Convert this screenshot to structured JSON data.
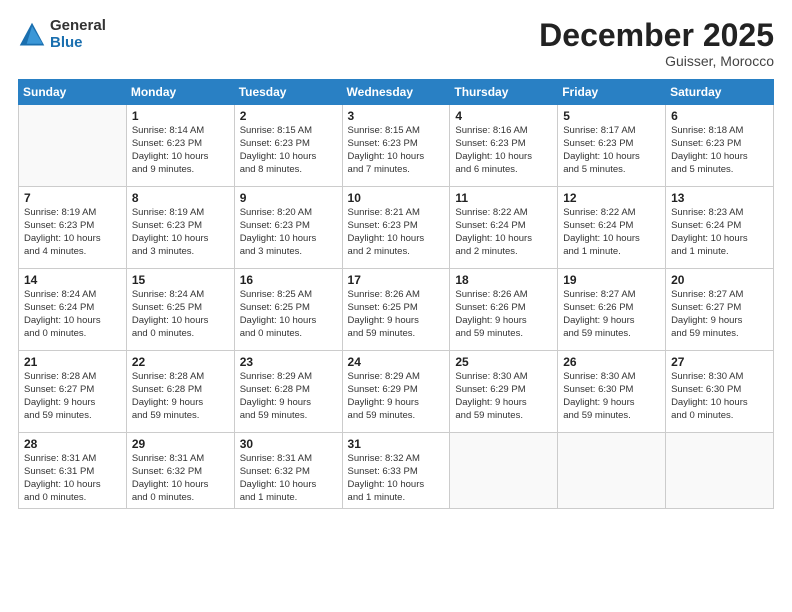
{
  "logo": {
    "general": "General",
    "blue": "Blue"
  },
  "title": "December 2025",
  "location": "Guisser, Morocco",
  "weekdays": [
    "Sunday",
    "Monday",
    "Tuesday",
    "Wednesday",
    "Thursday",
    "Friday",
    "Saturday"
  ],
  "weeks": [
    [
      {
        "day": "",
        "info": ""
      },
      {
        "day": "1",
        "info": "Sunrise: 8:14 AM\nSunset: 6:23 PM\nDaylight: 10 hours\nand 9 minutes."
      },
      {
        "day": "2",
        "info": "Sunrise: 8:15 AM\nSunset: 6:23 PM\nDaylight: 10 hours\nand 8 minutes."
      },
      {
        "day": "3",
        "info": "Sunrise: 8:15 AM\nSunset: 6:23 PM\nDaylight: 10 hours\nand 7 minutes."
      },
      {
        "day": "4",
        "info": "Sunrise: 8:16 AM\nSunset: 6:23 PM\nDaylight: 10 hours\nand 6 minutes."
      },
      {
        "day": "5",
        "info": "Sunrise: 8:17 AM\nSunset: 6:23 PM\nDaylight: 10 hours\nand 5 minutes."
      },
      {
        "day": "6",
        "info": "Sunrise: 8:18 AM\nSunset: 6:23 PM\nDaylight: 10 hours\nand 5 minutes."
      }
    ],
    [
      {
        "day": "7",
        "info": "Sunrise: 8:19 AM\nSunset: 6:23 PM\nDaylight: 10 hours\nand 4 minutes."
      },
      {
        "day": "8",
        "info": "Sunrise: 8:19 AM\nSunset: 6:23 PM\nDaylight: 10 hours\nand 3 minutes."
      },
      {
        "day": "9",
        "info": "Sunrise: 8:20 AM\nSunset: 6:23 PM\nDaylight: 10 hours\nand 3 minutes."
      },
      {
        "day": "10",
        "info": "Sunrise: 8:21 AM\nSunset: 6:23 PM\nDaylight: 10 hours\nand 2 minutes."
      },
      {
        "day": "11",
        "info": "Sunrise: 8:22 AM\nSunset: 6:24 PM\nDaylight: 10 hours\nand 2 minutes."
      },
      {
        "day": "12",
        "info": "Sunrise: 8:22 AM\nSunset: 6:24 PM\nDaylight: 10 hours\nand 1 minute."
      },
      {
        "day": "13",
        "info": "Sunrise: 8:23 AM\nSunset: 6:24 PM\nDaylight: 10 hours\nand 1 minute."
      }
    ],
    [
      {
        "day": "14",
        "info": "Sunrise: 8:24 AM\nSunset: 6:24 PM\nDaylight: 10 hours\nand 0 minutes."
      },
      {
        "day": "15",
        "info": "Sunrise: 8:24 AM\nSunset: 6:25 PM\nDaylight: 10 hours\nand 0 minutes."
      },
      {
        "day": "16",
        "info": "Sunrise: 8:25 AM\nSunset: 6:25 PM\nDaylight: 10 hours\nand 0 minutes."
      },
      {
        "day": "17",
        "info": "Sunrise: 8:26 AM\nSunset: 6:25 PM\nDaylight: 9 hours\nand 59 minutes."
      },
      {
        "day": "18",
        "info": "Sunrise: 8:26 AM\nSunset: 6:26 PM\nDaylight: 9 hours\nand 59 minutes."
      },
      {
        "day": "19",
        "info": "Sunrise: 8:27 AM\nSunset: 6:26 PM\nDaylight: 9 hours\nand 59 minutes."
      },
      {
        "day": "20",
        "info": "Sunrise: 8:27 AM\nSunset: 6:27 PM\nDaylight: 9 hours\nand 59 minutes."
      }
    ],
    [
      {
        "day": "21",
        "info": "Sunrise: 8:28 AM\nSunset: 6:27 PM\nDaylight: 9 hours\nand 59 minutes."
      },
      {
        "day": "22",
        "info": "Sunrise: 8:28 AM\nSunset: 6:28 PM\nDaylight: 9 hours\nand 59 minutes."
      },
      {
        "day": "23",
        "info": "Sunrise: 8:29 AM\nSunset: 6:28 PM\nDaylight: 9 hours\nand 59 minutes."
      },
      {
        "day": "24",
        "info": "Sunrise: 8:29 AM\nSunset: 6:29 PM\nDaylight: 9 hours\nand 59 minutes."
      },
      {
        "day": "25",
        "info": "Sunrise: 8:30 AM\nSunset: 6:29 PM\nDaylight: 9 hours\nand 59 minutes."
      },
      {
        "day": "26",
        "info": "Sunrise: 8:30 AM\nSunset: 6:30 PM\nDaylight: 9 hours\nand 59 minutes."
      },
      {
        "day": "27",
        "info": "Sunrise: 8:30 AM\nSunset: 6:30 PM\nDaylight: 10 hours\nand 0 minutes."
      }
    ],
    [
      {
        "day": "28",
        "info": "Sunrise: 8:31 AM\nSunset: 6:31 PM\nDaylight: 10 hours\nand 0 minutes."
      },
      {
        "day": "29",
        "info": "Sunrise: 8:31 AM\nSunset: 6:32 PM\nDaylight: 10 hours\nand 0 minutes."
      },
      {
        "day": "30",
        "info": "Sunrise: 8:31 AM\nSunset: 6:32 PM\nDaylight: 10 hours\nand 1 minute."
      },
      {
        "day": "31",
        "info": "Sunrise: 8:32 AM\nSunset: 6:33 PM\nDaylight: 10 hours\nand 1 minute."
      },
      {
        "day": "",
        "info": ""
      },
      {
        "day": "",
        "info": ""
      },
      {
        "day": "",
        "info": ""
      }
    ]
  ]
}
